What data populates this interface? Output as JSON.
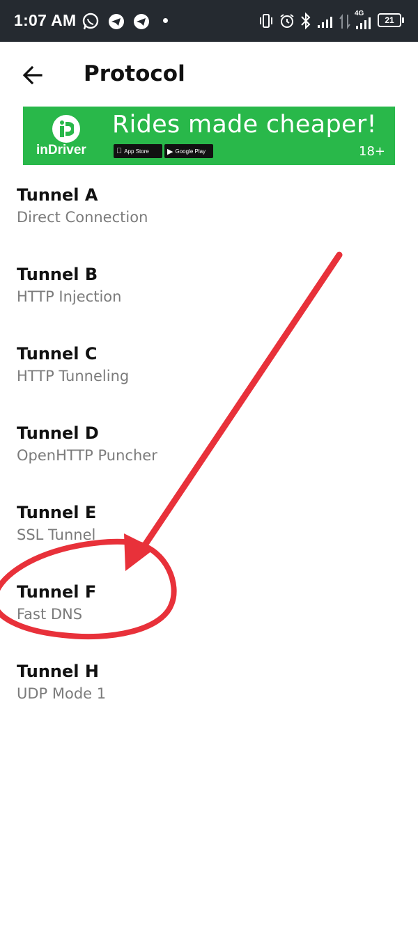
{
  "status_bar": {
    "time": "1:07 AM",
    "battery": "21",
    "network": "4G",
    "left_icons": [
      "whatsapp-icon",
      "telegram-icon",
      "telegram-icon"
    ],
    "right_icons": [
      "vibrate-icon",
      "alarm-icon",
      "bluetooth-icon",
      "signal-icon",
      "data-arrows-icon",
      "signal-4g-icon",
      "battery-icon"
    ]
  },
  "header": {
    "title": "Protocol",
    "back_icon": "arrow-left-icon"
  },
  "ad": {
    "brand": "inDriver",
    "headline": "Rides made cheaper!",
    "age": "18+",
    "app_store": "App Store",
    "google_play": "Google Play",
    "color": "#29b84a"
  },
  "tunnels": [
    {
      "title": "Tunnel A",
      "subtitle": "Direct Connection"
    },
    {
      "title": "Tunnel B",
      "subtitle": "HTTP Injection"
    },
    {
      "title": "Tunnel C",
      "subtitle": "HTTP Tunneling"
    },
    {
      "title": "Tunnel D",
      "subtitle": "OpenHTTP Puncher"
    },
    {
      "title": "Tunnel E",
      "subtitle": "SSL Tunnel"
    },
    {
      "title": "Tunnel F",
      "subtitle": "Fast DNS"
    },
    {
      "title": "Tunnel H",
      "subtitle": "UDP Mode 1"
    }
  ],
  "annotation": {
    "color": "#e8313a"
  }
}
